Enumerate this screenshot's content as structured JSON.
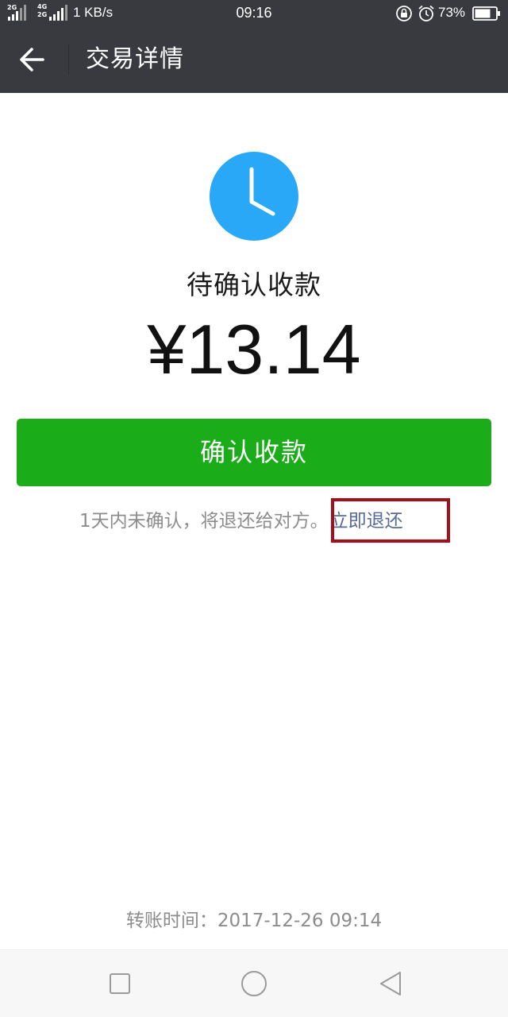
{
  "status_bar": {
    "sim1_label": "2G",
    "sim2_label_top": "4G",
    "sim2_label_bottom": "2G",
    "speed": "1 KB/s",
    "time": "09:16",
    "battery_percent": "73%"
  },
  "nav": {
    "title": "交易详情"
  },
  "transaction": {
    "status": "待确认收款",
    "amount": "¥13.14",
    "confirm_label": "确认收款",
    "note": "1天内未确认，将退还给对方。",
    "refund_link": "立即退还",
    "transfer_time_label": "转账时间：",
    "transfer_time_value": "2017-12-26 09:14"
  },
  "colors": {
    "header_bg": "#393a3f",
    "clock_blue": "#29a8f8",
    "confirm_green": "#1aad19",
    "link_blue": "#576b95",
    "highlight_red": "#a3101b",
    "muted_text": "#8c8c8c"
  },
  "icons": {
    "back": "arrow-left-icon",
    "clock": "clock-icon",
    "recent_apps": "square-icon",
    "home": "circle-icon",
    "system_back": "triangle-left-icon"
  }
}
